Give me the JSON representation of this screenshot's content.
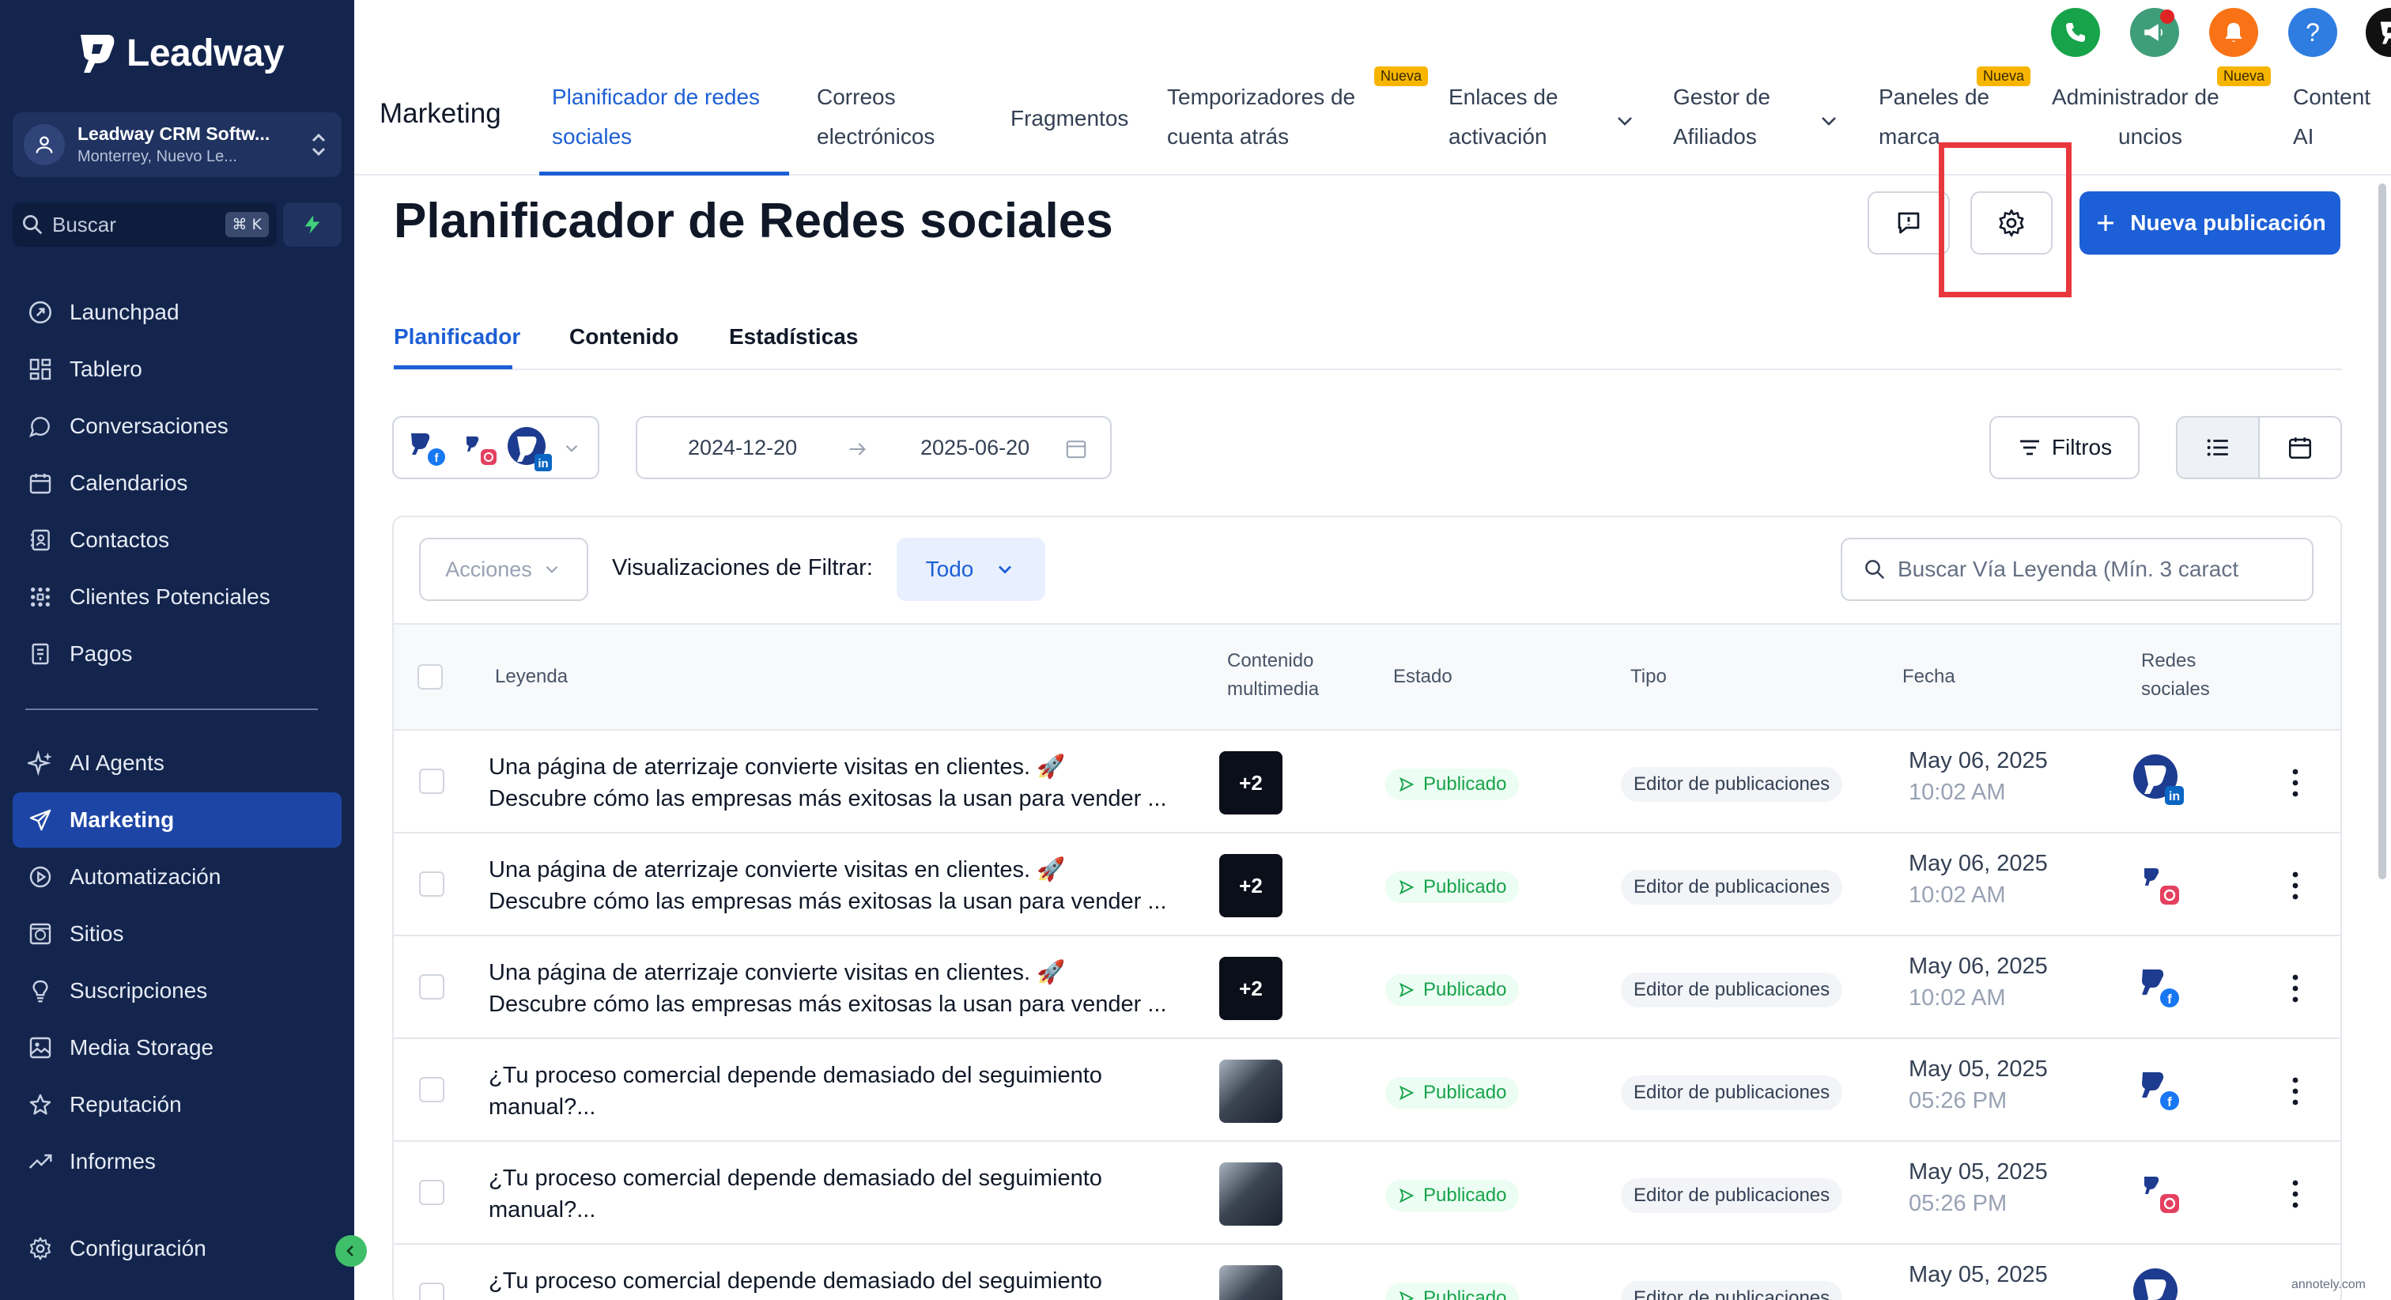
{
  "brand": {
    "name": "Leadway"
  },
  "location": {
    "name": "Leadway CRM Softw...",
    "address": "Monterrey, Nuevo Le..."
  },
  "sidebar": {
    "search_label": "Buscar",
    "search_shortcut": "⌘ K",
    "items": [
      {
        "label": "Launchpad",
        "icon": "rocket-icon"
      },
      {
        "label": "Tablero",
        "icon": "grid-icon"
      },
      {
        "label": "Conversaciones",
        "icon": "chat-icon"
      },
      {
        "label": "Calendarios",
        "icon": "calendar-icon"
      },
      {
        "label": "Contactos",
        "icon": "contacts-icon"
      },
      {
        "label": "Clientes Potenciales",
        "icon": "pipeline-icon"
      },
      {
        "label": "Pagos",
        "icon": "payments-icon"
      }
    ],
    "items2": [
      {
        "label": "AI Agents",
        "icon": "sparkle-icon"
      },
      {
        "label": "Marketing",
        "icon": "send-icon",
        "active": true
      },
      {
        "label": "Automatización",
        "icon": "automation-icon"
      },
      {
        "label": "Sitios",
        "icon": "globe-icon"
      },
      {
        "label": "Suscripciones",
        "icon": "membership-icon"
      },
      {
        "label": "Media Storage",
        "icon": "image-icon"
      },
      {
        "label": "Reputación",
        "icon": "star-icon"
      },
      {
        "label": "Informes",
        "icon": "trend-icon"
      }
    ],
    "settings_label": "Configuración"
  },
  "topnav": {
    "section": "Marketing",
    "tabs": [
      {
        "line1": "Planificador de redes",
        "line2": "sociales",
        "active": true
      },
      {
        "line1": "Correos",
        "line2": "electrónicos"
      },
      {
        "line1": "Fragmentos",
        "line2": ""
      },
      {
        "line1": "Temporizadores de",
        "line2": "cuenta atrás",
        "badge": "Nueva"
      },
      {
        "line1": "Enlaces de",
        "line2": "activación"
      },
      {
        "line1": "Gestor de",
        "line2": "Afiliados"
      },
      {
        "line1": "Paneles de",
        "line2": "marca",
        "badge": "Nueva"
      },
      {
        "line1": "Administrador de",
        "line2": "uncios",
        "badge": "Nueva"
      },
      {
        "line1": "Content",
        "line2": "AI"
      }
    ]
  },
  "header_icons": [
    {
      "icon": "phone-icon",
      "color": "#16a34a"
    },
    {
      "icon": "megaphone-icon",
      "color": "#3f9e7a"
    },
    {
      "icon": "bell-icon",
      "color": "#f97316"
    },
    {
      "icon": "help-icon",
      "color": "#2f7de1"
    },
    {
      "icon": "leadway-logo-icon",
      "color": "#111111"
    }
  ],
  "page": {
    "title": "Planificador de Redes sociales",
    "new_post_label": "Nueva publicación",
    "tabs": [
      "Planificador",
      "Contenido",
      "Estadísticas"
    ]
  },
  "filters": {
    "date_start": "2024-12-20",
    "date_end": "2025-06-20",
    "filters_label": "Filtros"
  },
  "table_toolbar": {
    "actions_label": "Acciones",
    "view_filter_label": "Visualizaciones de Filtrar:",
    "view_filter_value": "Todo",
    "search_placeholder": "Buscar Vía Leyenda (Mín. 3 caract"
  },
  "columns": {
    "caption": "Leyenda",
    "media_1": "Contenido",
    "media_2": "multimedia",
    "status": "Estado",
    "type": "Tipo",
    "date": "Fecha",
    "social_1": "Redes",
    "social_2": "sociales"
  },
  "rows": [
    {
      "line1": "Una página de aterrizaje convierte visitas en clientes. 🚀",
      "line2": "Descubre cómo las empresas más exitosas la usan para vender ...",
      "media_more": "+2",
      "status": "Publicado",
      "type": "Editor de publicaciones",
      "date": "May 06, 2025",
      "time": "10:02 AM",
      "network": "linkedin"
    },
    {
      "line1": "Una página de aterrizaje convierte visitas en clientes. 🚀",
      "line2": "Descubre cómo las empresas más exitosas la usan para vender ...",
      "media_more": "+2",
      "status": "Publicado",
      "type": "Editor de publicaciones",
      "date": "May 06, 2025",
      "time": "10:02 AM",
      "network": "instagram"
    },
    {
      "line1": "Una página de aterrizaje convierte visitas en clientes. 🚀",
      "line2": "Descubre cómo las empresas más exitosas la usan para vender ...",
      "media_more": "+2",
      "status": "Publicado",
      "type": "Editor de publicaciones",
      "date": "May 06, 2025",
      "time": "10:02 AM",
      "network": "facebook"
    },
    {
      "line1": "¿Tu proceso comercial depende demasiado del seguimiento",
      "line2": "manual?...",
      "media_more": "",
      "status": "Publicado",
      "type": "Editor de publicaciones",
      "date": "May 05, 2025",
      "time": "05:26 PM",
      "network": "facebook"
    },
    {
      "line1": "¿Tu proceso comercial depende demasiado del seguimiento",
      "line2": "manual?...",
      "media_more": "",
      "status": "Publicado",
      "type": "Editor de publicaciones",
      "date": "May 05, 2025",
      "time": "05:26 PM",
      "network": "instagram"
    },
    {
      "line1": "¿Tu proceso comercial depende demasiado del seguimiento",
      "line2": "",
      "media_more": "",
      "status": "Publicado",
      "type": "Editor de publicaciones",
      "date": "May 05, 2025",
      "time": "",
      "network": "linkedin"
    }
  ],
  "watermark": "annotely.com",
  "colors": {
    "sidebar": "#13254d",
    "accent": "#1d5fd6",
    "highlight": "#e8373d",
    "success": "#17a34a"
  }
}
